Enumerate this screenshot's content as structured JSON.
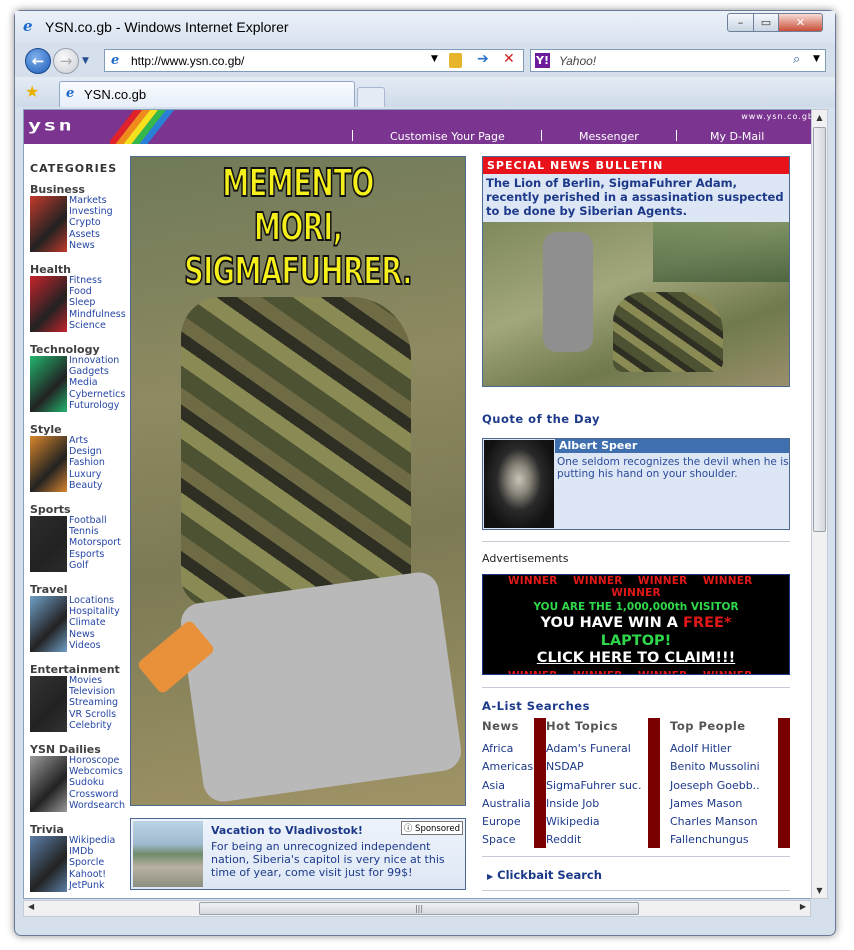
{
  "window": {
    "title": "YSN.co.gb - Windows Internet Explorer"
  },
  "browser": {
    "url": "http://www.ysn.co.gb/",
    "search_placeholder": "Yahoo!",
    "tab_title": "YSN.co.gb"
  },
  "header": {
    "logo": "ysn",
    "site_url": "www.ysn.co.gb",
    "links": [
      "Customise Your Page",
      "Messenger",
      "My D-Mail"
    ],
    "rainbow_colors": [
      "#e0202a",
      "#f08a1c",
      "#f7e11d",
      "#33b94a",
      "#2a7fd6"
    ]
  },
  "categories": {
    "heading": "CATEGORIES",
    "groups": [
      {
        "name": "Business",
        "links": [
          "Markets",
          "Investing",
          "Crypto",
          "Assets",
          "News"
        ],
        "color": "#c33a2b"
      },
      {
        "name": "Health",
        "links": [
          "Fitness",
          "Food",
          "Sleep",
          "Mindfulness",
          "Science"
        ],
        "color": "#c7242d"
      },
      {
        "name": "Technology",
        "links": [
          "Innovation",
          "Gadgets",
          "Media",
          "Cybernetics",
          "Futurology"
        ],
        "color": "#23b56d"
      },
      {
        "name": "Style",
        "links": [
          "Arts",
          "Design",
          "Fashion",
          "Luxury",
          "Beauty"
        ],
        "color": "#d9862d"
      },
      {
        "name": "Sports",
        "links": [
          "Football",
          "Tennis",
          "Motorsport",
          "Esports",
          "Golf"
        ],
        "color": "#2b2b2b"
      },
      {
        "name": "Travel",
        "links": [
          "Locations",
          "Hospitality",
          "Climate",
          "News",
          "Videos"
        ],
        "color": "#6fa0c8"
      },
      {
        "name": "Entertainment",
        "links": [
          "Movies",
          "Television",
          "Streaming",
          "VR Scrolls",
          "Celebrity"
        ],
        "color": "#333333"
      },
      {
        "name": "YSN Dailies",
        "links": [
          "Horoscope",
          "Webcomics",
          "Sudoku",
          "Crossword",
          "Wordsearch"
        ],
        "color": "#9a9a9a"
      },
      {
        "name": "Trivia",
        "links": [
          "Wikipedia",
          "IMDb",
          "Sporcle",
          "Kahoot!",
          "JetPunk"
        ],
        "color": "#5c7fa8"
      }
    ]
  },
  "hero": {
    "headline_line1": "MEMENTO MORI,",
    "headline_line2": "SIGMAFUHRER."
  },
  "sponsored": {
    "badge": "Sponsored",
    "title": "Vacation to Vladivostok!",
    "text": "For being an unrecognized independent nation, Siberia's capitol is very nice at this time of year, come visit just for 99$!"
  },
  "bulletin": {
    "heading": "SPECIAL NEWS BULLETIN",
    "text": "The Lion of Berlin, SigmaFuhrer Adam, recently perished in a assasination suspected to be done by Siberian Agents."
  },
  "quote": {
    "heading": "Quote of the Day",
    "author": "Albert Speer",
    "text": "One seldom recognizes the devil when he is putting his hand on your shoulder."
  },
  "ads": {
    "heading": "Advertisements",
    "winner": "WINNER",
    "visitor": "YOU ARE THE 1,000,000th VISITOR",
    "big_prefix": "YOU HAVE WIN A ",
    "big_free": "FREE*",
    "laptop": "LAPTOP!",
    "click": "CLICK HERE TO CLAIM!!!"
  },
  "alist": {
    "heading": "A-List Searches",
    "columns": [
      {
        "title": "News",
        "items": [
          "Africa",
          "Americas",
          "Asia",
          "Australia",
          "Europe",
          "Space"
        ]
      },
      {
        "title": "Hot Topics",
        "items": [
          "Adam's Funeral",
          "NSDAP",
          "SigmaFuhrer suc.",
          "Inside Job",
          "Wikipedia",
          "Reddit"
        ]
      },
      {
        "title": "Top People",
        "items": [
          "Adolf Hitler",
          "Benito Mussolini",
          "Joeseph Goebb..",
          "James Mason",
          "Charles Manson",
          "Fallenchungus"
        ]
      }
    ],
    "clickbait": "Clickbait Search"
  }
}
